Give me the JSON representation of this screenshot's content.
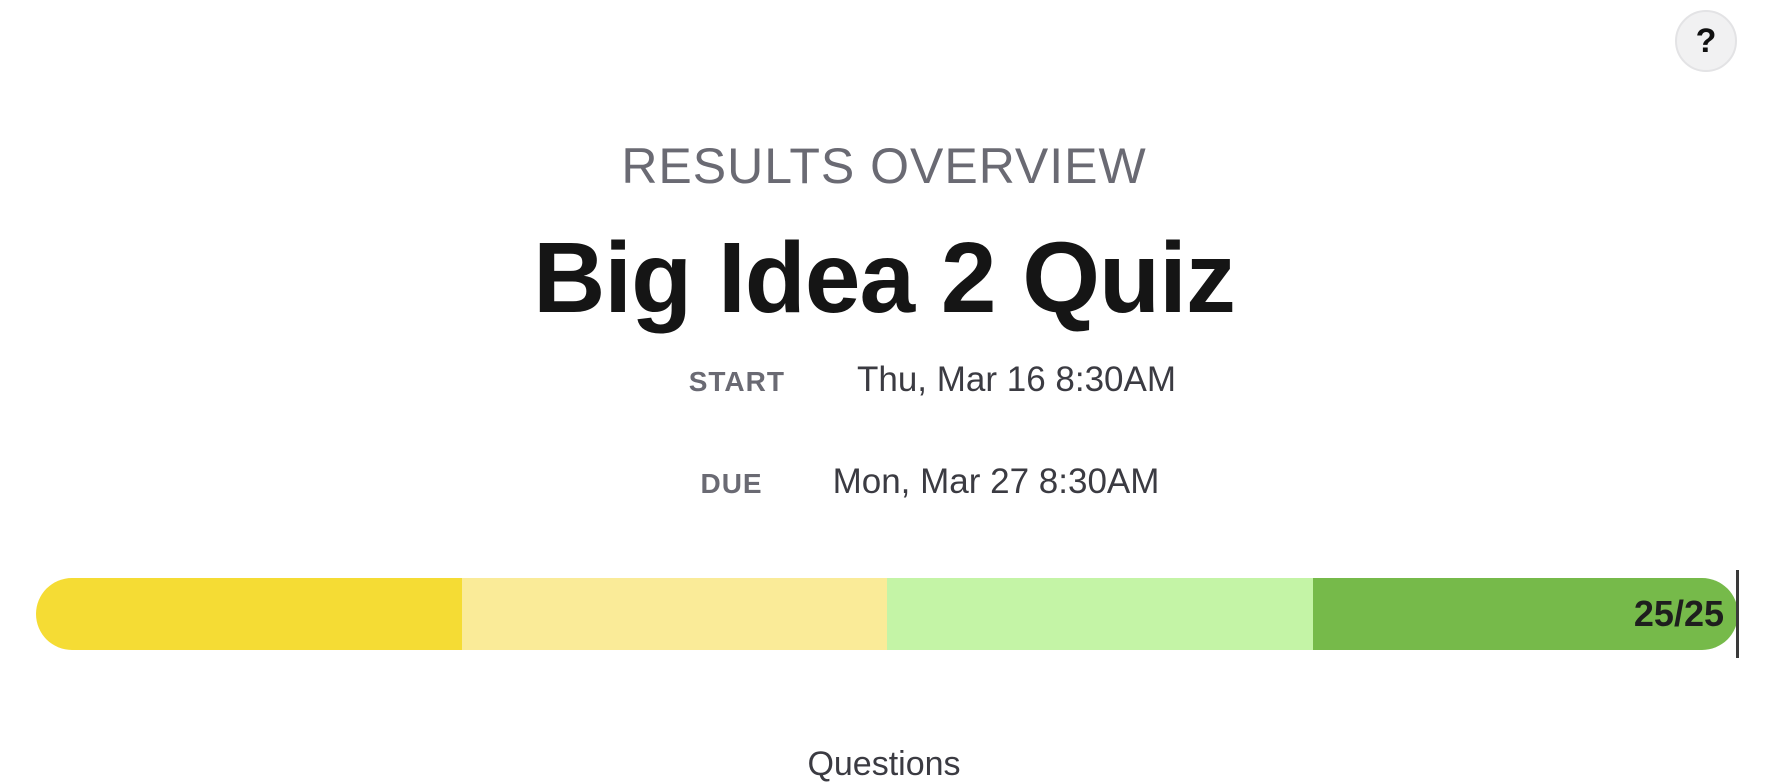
{
  "help": {
    "label": "?"
  },
  "header": {
    "overline": "RESULTS OVERVIEW",
    "title": "Big Idea 2 Quiz"
  },
  "dates": {
    "start_label": "START",
    "start_value": "Thu, Mar 16 8:30AM",
    "due_label": "DUE",
    "due_value": "Mon, Mar 27 8:30AM"
  },
  "progress": {
    "label": "25/25",
    "completed": 25,
    "total": 25,
    "segments": [
      {
        "color": "#f5dc34"
      },
      {
        "color": "#faeb98"
      },
      {
        "color": "#c4f4a6"
      },
      {
        "color": "#76ba4a"
      }
    ]
  },
  "questions": {
    "title": "Questions"
  }
}
